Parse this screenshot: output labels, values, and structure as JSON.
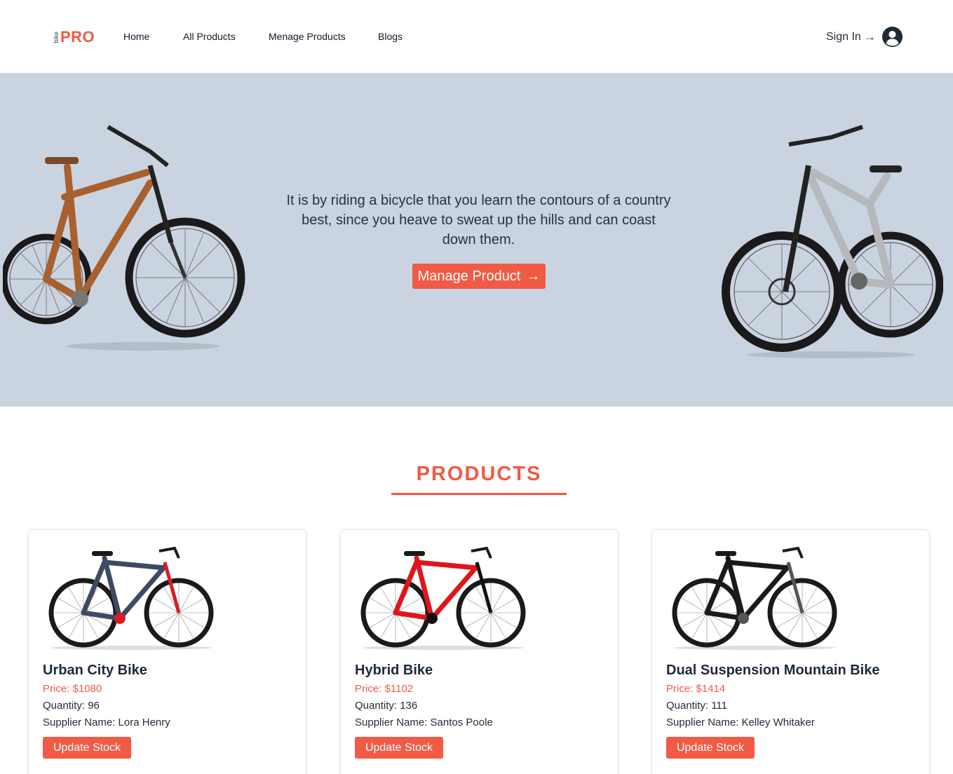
{
  "nav": {
    "logo_small": "bike",
    "logo_main": "PRO",
    "links": [
      "Home",
      "All Products",
      "Menage Products",
      "Blogs"
    ],
    "signin_label": "Sign In",
    "signin_arrow": "→"
  },
  "hero": {
    "quote": "It is by riding a bicycle that you learn the contours of a country best, since you heave to sweat up the hills and can coast down them.",
    "button_label": "Manage Product",
    "button_arrow": "→"
  },
  "products": {
    "title": "PRODUCTS",
    "items": [
      {
        "name": "Urban City Bike",
        "price": "Price: $1080",
        "quantity": "Quantity: 96",
        "supplier": "Supplier Name: Lora Henry",
        "button": "Update Stock",
        "frame_color": "#3c4a63",
        "accent_color": "#d91c24"
      },
      {
        "name": "Hybrid Bike",
        "price": "Price: $1102",
        "quantity": "Quantity: 136",
        "supplier": "Supplier Name: Santos Poole",
        "button": "Update Stock",
        "frame_color": "#e0151b",
        "accent_color": "#111111"
      },
      {
        "name": "Dual Suspension Mountain Bike",
        "price": "Price: $1414",
        "quantity": "Quantity: 111",
        "supplier": "Supplier Name: Kelley Whitaker",
        "button": "Update Stock",
        "frame_color": "#1a1a1a",
        "accent_color": "#555555"
      }
    ]
  },
  "colors": {
    "accent": "#f15a45",
    "hero_bg": "#cad4e0",
    "text": "#1f2937"
  },
  "icons": {
    "signin": "arrow-right-icon",
    "avatar": "user-circle-icon",
    "hero_button": "arrow-right-icon"
  }
}
